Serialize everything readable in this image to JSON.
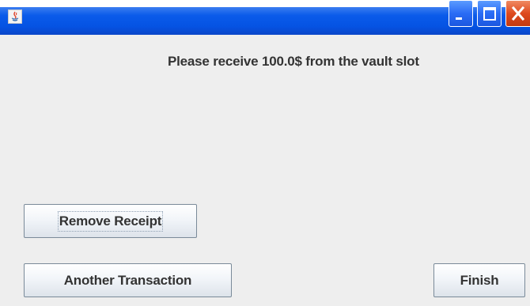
{
  "window": {
    "title": "",
    "icon": "java-app-icon",
    "controls": {
      "minimize": "minimize-icon",
      "maximize": "maximize-icon",
      "close": "close-icon"
    },
    "accent_colors": {
      "titlebar": "#0553e3",
      "close": "#de4a1e",
      "background": "#eeeeee"
    }
  },
  "main": {
    "message": "Please receive 100.0$ from the vault slot"
  },
  "buttons": {
    "remove_receipt": "Remove Receipt",
    "another_transaction": "Another Transaction",
    "finish": "Finish"
  }
}
